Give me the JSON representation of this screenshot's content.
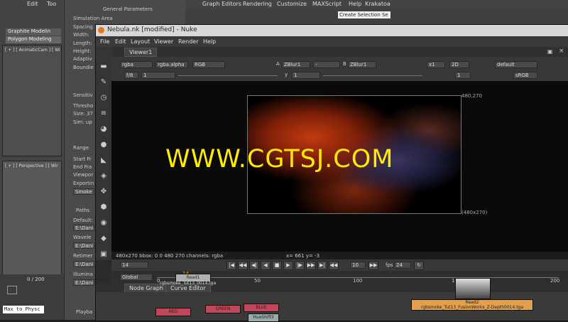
{
  "max": {
    "menu": [
      "Edit",
      "Too"
    ],
    "top_menu": [
      "Graph Editors",
      "Rendering",
      "Customize",
      "MAXScript",
      "Help",
      "Krakatoa"
    ],
    "selection_set": "Create Selection Se",
    "graphite_label": "Graphite Modelin",
    "polygon_label": "Polygon Modeling",
    "viewport1_label": "[ + ] [ AnimaticCam ] [ Wi",
    "viewport2_label": "[ + ] [ Perspective ] [ Wir",
    "frame_counter": "0 / 200",
    "prompt_text": "Max to Physc",
    "panel": {
      "section_title": "General Parameters",
      "simulation_area": "Simulation Area",
      "spacing": "Spacing",
      "width": "Width:",
      "length": "Length:",
      "height": "Height:",
      "adaptive": "Adaptiv",
      "boundaries": "Boundie",
      "sensitivity": "Sensitiv",
      "threshold": "Thresho",
      "size": "Size: 37",
      "sim_up": "Sim: up",
      "range": "Range",
      "start_frame": "Start Fr",
      "end_frame": "End Fra",
      "viewport": "Viewpor",
      "exporting": "Exportin",
      "smoke_field": "Smoke",
      "paths": "Paths",
      "default": "Default:",
      "path1": "E:\\Dani",
      "wavelet": "Wavele",
      "path2": "E:\\Dani",
      "retimer": "Retimer",
      "path3": "E:\\Dani",
      "illumination": "Illumina",
      "path4": "E:\\Dani",
      "playback": "Playba"
    }
  },
  "nuke": {
    "title": "Nebula.nk [modified] - Nuke",
    "menu": [
      "File",
      "Edit",
      "Layout",
      "Viewer",
      "Render",
      "Help"
    ],
    "viewer_tab": "Viewer1",
    "channels": "rgba",
    "alpha": "rgba.alpha",
    "colorspace": "RGB",
    "input_a_label": "A",
    "input_a": "ZBlur1",
    "input_a_op": "-",
    "input_b_label": "B",
    "input_b": "ZBlur1",
    "zoom": "x1",
    "view_mode": "2D",
    "lut_default": "default",
    "fstop_label": "f/8",
    "gain": "1",
    "gamma_label": "y",
    "gamma": "1",
    "frame_field": "1",
    "lut": "sRGB",
    "resolution_top": "480,270",
    "resolution_bottom": "(480x270)",
    "watermark": "WWW.CGTSJ.COM",
    "info": "480x270 bbox: 0 0 480 270 channels: rgba",
    "coords": "x= 661 y=  -3",
    "current_frame": "14",
    "increment": "10",
    "fps_label": "fps",
    "fps": "24",
    "range_mode": "Global",
    "timeline_ticks": [
      "0",
      "14",
      "50",
      "100",
      "150",
      "200"
    ],
    "timeline_end": "200",
    "tabs": [
      "Node Graph",
      "Curve Editor"
    ],
    "nodes": {
      "read1": "Read1",
      "read1_file": "rgbsmoke_Tut13_0014.tga",
      "red": "RED",
      "green": "GREEN",
      "blue": "BLUE",
      "hueshift": "HueShift3",
      "read2": "Read2",
      "read2_file": "rgbsmoke_Tut13_FusionWorks_Z-Depth0014.tga"
    }
  },
  "colors": {
    "watermark": "#ffec00",
    "node_read": "#b0b0b0",
    "node_red": "#c0485a",
    "node_read2": "#e0a050"
  }
}
